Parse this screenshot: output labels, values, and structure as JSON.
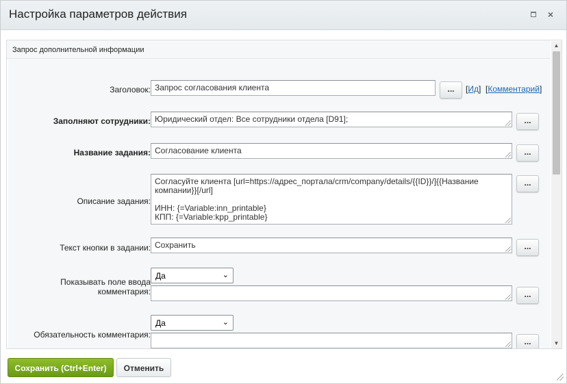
{
  "window": {
    "title": "Настройка параметров действия",
    "maximize_icon": "maximize-icon",
    "close_label": "×"
  },
  "section": {
    "title": "Запрос дополнительной информации"
  },
  "form": {
    "header": {
      "label": "Заголовок:",
      "value": "Запрос согласования клиента",
      "button": "...",
      "link_id_open": "[",
      "link_id": "Ид",
      "link_id_close": "]",
      "link_comment_open": "[",
      "link_comment": "Комментарий",
      "link_comment_close": "]"
    },
    "assignees": {
      "label": "Заполняют сотрудники:",
      "value": "Юридический отдел: Все сотрудники отдела [D91];",
      "button": "..."
    },
    "task_name": {
      "label": "Название задания:",
      "value": "Согласование клиента",
      "button": "..."
    },
    "task_description": {
      "label": "Описание задания:",
      "value": "Согласуйте клиента [url=https://адрес_портала/crm/company/details/{{ID}}/]{{Название компании}}[/url]\n\nИНН: {=Variable:inn_printable}\nКПП: {=Variable:kpp_printable}",
      "button": "..."
    },
    "button_text": {
      "label": "Текст кнопки в задании:",
      "value": "Сохранить",
      "button": "..."
    },
    "show_comment": {
      "label_line1": "Показывать поле ввода",
      "label_line2": "комментария:",
      "select_value": "Да",
      "value": "",
      "button": "..."
    },
    "comment_required": {
      "label": "Обязательность комментария:",
      "select_value": "Да",
      "value": "",
      "button": "..."
    }
  },
  "footer": {
    "save_label": "Сохранить (Ctrl+Enter)",
    "cancel_label": "Отменить"
  },
  "colors": {
    "save_button": "#7aab1e",
    "link": "#2067b0"
  }
}
